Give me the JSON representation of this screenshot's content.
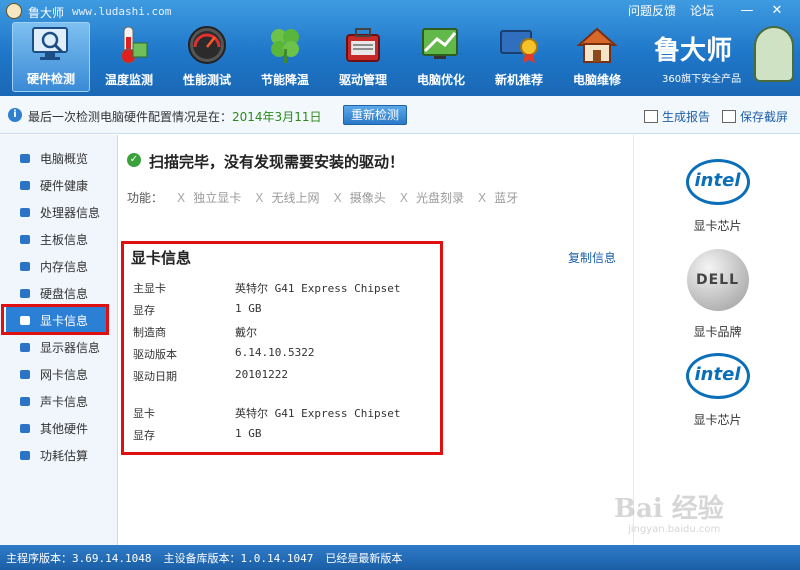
{
  "window": {
    "title": "鲁大师",
    "url": "www.ludashi.com",
    "links": [
      "问题反馈",
      "论坛"
    ]
  },
  "nav": [
    {
      "label": "硬件检测",
      "icon": "monitor-magnifier-icon",
      "active": true
    },
    {
      "label": "温度监测",
      "icon": "thermometer-icon"
    },
    {
      "label": "性能测试",
      "icon": "speedometer-icon"
    },
    {
      "label": "节能降温",
      "icon": "clover-icon"
    },
    {
      "label": "驱动管理",
      "icon": "toolbox-icon"
    },
    {
      "label": "电脑优化",
      "icon": "optimize-screen-icon"
    },
    {
      "label": "新机推荐",
      "icon": "award-monitor-icon"
    },
    {
      "label": "电脑维修",
      "icon": "house-icon"
    }
  ],
  "brand": {
    "name": "鲁大师",
    "subtitle": "360旗下安全产品"
  },
  "infobar": {
    "prefix": "最后一次检测电脑硬件配置情况是在：",
    "date": "2014年3月11日",
    "rescan": "重新检测",
    "report": "生成报告",
    "screenshot": "保存截屏"
  },
  "sidebar": [
    "电脑概览",
    "硬件健康",
    "处理器信息",
    "主板信息",
    "内存信息",
    "硬盘信息",
    "显卡信息",
    "显示器信息",
    "网卡信息",
    "声卡信息",
    "其他硬件",
    "功耗估算"
  ],
  "sidebar_active": "显卡信息",
  "scan": {
    "title": "扫描完毕，没有发现需要安装的驱动！",
    "func_label": "功能：",
    "functions": [
      "独立显卡",
      "无线上网",
      "摄像头",
      "光盘刻录",
      "蓝牙"
    ]
  },
  "card": {
    "title": "显卡信息",
    "copy": "复制信息",
    "rows": [
      {
        "k": "主显卡",
        "v": "英特尔 G41 Express Chipset"
      },
      {
        "k": "显存",
        "v": "1 GB"
      },
      {
        "k": "制造商",
        "v": "戴尔"
      },
      {
        "k": "驱动版本",
        "v": "6.14.10.5322"
      },
      {
        "k": "驱动日期",
        "v": "20101222"
      },
      {
        "k": "显卡",
        "v": "英特尔 G41 Express Chipset"
      },
      {
        "k": "显存",
        "v": "1 GB"
      }
    ]
  },
  "right": [
    {
      "logo": "intel",
      "caption": "显卡芯片"
    },
    {
      "logo": "DELL",
      "caption": "显卡品牌"
    },
    {
      "logo": "intel",
      "caption": "显卡芯片"
    }
  ],
  "status": {
    "main_version": "主程序版本：3.69.14.1048",
    "db_version": "主设备库版本：1.0.14.1047",
    "state": "已经是最新版本"
  },
  "watermark": {
    "text": "Bai 经验",
    "sub": "jingyan.baidu.com"
  }
}
